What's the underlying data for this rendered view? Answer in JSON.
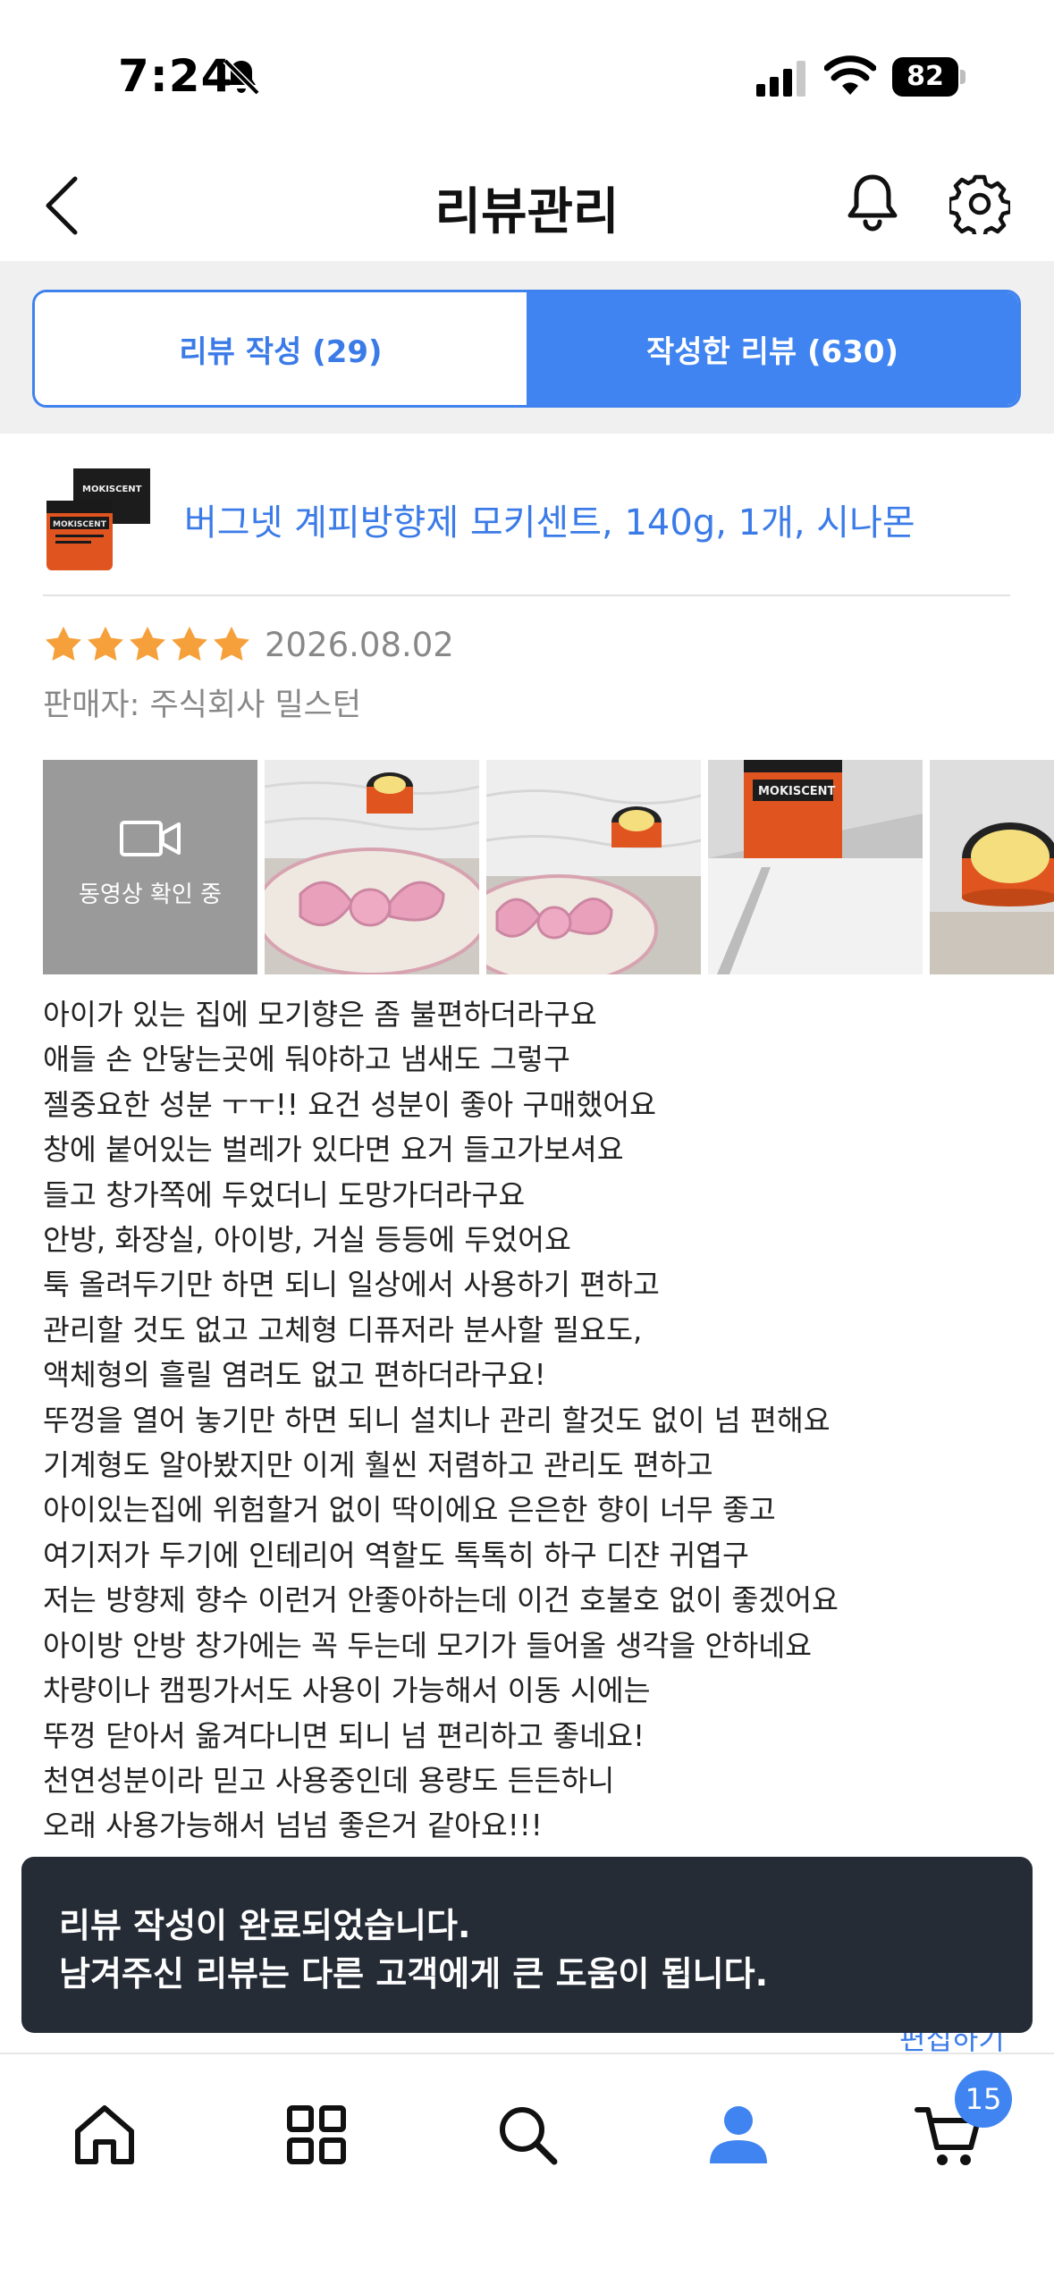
{
  "status_bar": {
    "time": "7:24",
    "battery": "82",
    "icons": [
      "bell-slash-icon",
      "cellular-signal-icon",
      "wifi-icon",
      "battery-icon"
    ]
  },
  "header": {
    "title": "리뷰관리",
    "icons": [
      "back-arrow-icon",
      "bell-icon",
      "gear-icon"
    ]
  },
  "tabs": [
    {
      "label": "리뷰 작성 (29)",
      "selected": false
    },
    {
      "label": "작성한 리뷰 (630)",
      "selected": true
    }
  ],
  "product": {
    "name": "버그넷 계피방향제 모키센트, 140g, 1개, 시나몬",
    "thumb_brand": "MOKISCENT"
  },
  "review": {
    "rating": 5,
    "date": "2026.08.02",
    "seller": "판매자: 주식회사 밀스턴",
    "video_label": "동영상 확인 중",
    "lines": [
      "아이가 있는 집에 모기향은 좀 불편하더라구요",
      "애들 손 안닿는곳에 둬야하고 냄새도 그렇구",
      "젤중요한 성분 ㅜㅜ!! 요건 성분이 좋아 구매했어요",
      "창에 붙어있는 벌레가 있다면 요거 들고가보셔요",
      "들고 창가쪽에 두었더니 도망가더라구요",
      "안방, 화장실, 아이방, 거실 등등에 두었어요",
      "툭 올려두기만 하면 되니 일상에서 사용하기 편하고",
      "관리할 것도 없고 고체형 디퓨저라 분사할 필요도,",
      "액체형의 흘릴 염려도 없고 편하더라구요!",
      "뚜껑을 열어 놓기만 하면 되니 설치나 관리 할것도 없이 넘 편해요",
      "기계형도 알아봤지만 이게 훨씬 저렴하고 관리도 편하고",
      "아이있는집에 위험할거 없이 딱이에요 은은한 향이 너무 좋고",
      "여기저가 두기에 인테리어 역할도 톡톡히 하구 디쟌 귀엽구",
      "저는 방향제 향수 이런거 안좋아하는데 이건 호불호 없이 좋겠어요",
      "아이방 안방 창가에는 꼭 두는데 모기가 들어올 생각을 안하네요",
      "차량이나 캠핑가서도 사용이 가능해서 이동 시에는",
      "뚜껑 닫아서 옮겨다니면 되니 넘 편리하고 좋네요!",
      "천연성분이라 믿고 사용중인데 용량도 든든하니",
      "오래 사용가능해서 넘넘 좋은거 같아요!!!"
    ],
    "edit_label": "편집하기"
  },
  "toast": {
    "line1": "리뷰 작성이 완료되었습니다.",
    "line2": "남겨주신 리뷰는 다른 고객에게 큰 도움이 됩니다."
  },
  "bottom_nav": {
    "items": [
      "home-icon",
      "categories-icon",
      "search-icon",
      "my-page-icon",
      "cart-icon"
    ],
    "cart_count": "15"
  },
  "colors": {
    "accent": "#3f84f0",
    "link": "#3b7be8",
    "star": "#f5a03a",
    "toast_bg": "#252c36"
  }
}
